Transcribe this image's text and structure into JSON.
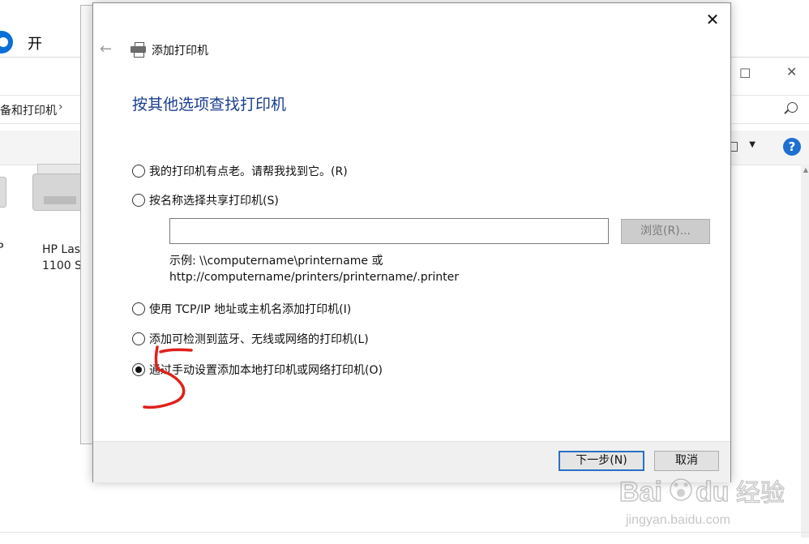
{
  "background": {
    "top_label": "开",
    "breadcrumb": "备和打印机",
    "printer_label": "HP Las\n1100 S",
    "left_letter": "P",
    "help_icon": "?"
  },
  "dialog": {
    "title": "添加打印机",
    "heading": "按其他选项查找打印机",
    "close_glyph": "✕",
    "back_glyph": "←",
    "options": [
      {
        "label": "我的打印机有点老。请帮我找到它。(R)",
        "checked": false
      },
      {
        "label": "按名称选择共享打印机(S)",
        "checked": false
      },
      {
        "label": "使用 TCP/IP 地址或主机名添加打印机(I)",
        "checked": false
      },
      {
        "label": "添加可检测到蓝牙、无线或网络的打印机(L)",
        "checked": false
      },
      {
        "label": "通过手动设置添加本地打印机或网络打印机(O)",
        "checked": true
      }
    ],
    "share_input": {
      "value": "",
      "placeholder": ""
    },
    "browse_label": "浏览(R)...",
    "example_line1": "示例: \\\\computername\\printername 或",
    "example_line2": "http://computername/printers/printername/.printer",
    "next_label": "下一步(N)",
    "cancel_label": "取消"
  },
  "watermark": {
    "brand": "Bai du 经验",
    "url": "jingyan.baidu.com"
  },
  "colors": {
    "heading": "#1a3e8f",
    "accent": "#2a6fc4",
    "annotation": "#e0201b"
  }
}
